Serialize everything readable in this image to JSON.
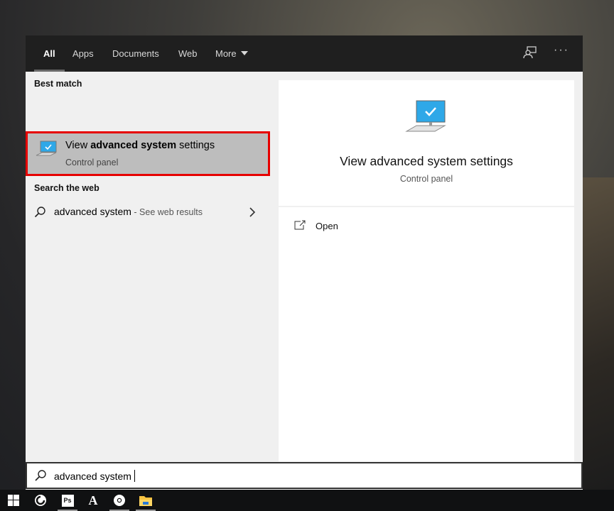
{
  "tabs": [
    {
      "label": "All",
      "active": true
    },
    {
      "label": "Apps"
    },
    {
      "label": "Documents"
    },
    {
      "label": "Web"
    },
    {
      "label": "More"
    }
  ],
  "header_icons": [
    "feedback-icon",
    "more-options-icon"
  ],
  "left": {
    "best_match_heading": "Best match",
    "best_match": {
      "title_pre": "View ",
      "title_bold": "advanced system",
      "title_post": " settings",
      "subtitle": "Control panel",
      "icon": "computer-settings-icon"
    },
    "web_heading": "Search the web",
    "web_result": {
      "query": "advanced system",
      "suffix": " - See web results"
    }
  },
  "preview": {
    "title": "View advanced system settings",
    "subtitle": "Control panel",
    "actions": [
      {
        "label": "Open",
        "icon": "open-icon"
      }
    ]
  },
  "search": {
    "value": "advanced system"
  },
  "taskbar": [
    "windows-start-icon",
    "firefox-icon",
    "photoshop-icon",
    "font-app-icon",
    "chrome-icon",
    "file-explorer-icon"
  ],
  "colors": {
    "highlight_border": "#e60000",
    "selected_bg": "#bdbdbd",
    "header_bg": "#1f1f1f",
    "accent": "#2ea8e8"
  }
}
